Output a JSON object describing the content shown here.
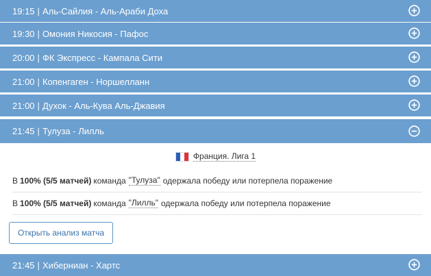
{
  "matches": [
    {
      "time": "19:15",
      "teams": "Аль-Сайлия - Аль-Араби Доха",
      "icon": "plus-circle-icon"
    },
    {
      "time": "19:30",
      "teams": "Омония Никосия - Пафос",
      "icon": "plus-circle-icon"
    },
    {
      "time": "20:00",
      "teams": "ФК Экспресс - Кампала Сити",
      "icon": "plus-circle-icon"
    },
    {
      "time": "21:00",
      "teams": "Копенгаген - Норшелланн",
      "icon": "plus-circle-icon"
    },
    {
      "time": "21:00",
      "teams": "Духок - Аль-Кува Аль-Джавия",
      "icon": "plus-circle-icon"
    },
    {
      "time": "21:45",
      "teams": "Тулуза - Лилль",
      "icon": "minus-circle-icon"
    },
    {
      "time": "21:45",
      "teams": "Хиберниан - Хартс",
      "icon": "plus-circle-icon"
    }
  ],
  "separator": "|",
  "expanded": {
    "league_name": "Франция. Лига 1",
    "flag_colors": [
      "#2c5eb5",
      "#ffffff",
      "#e0333a"
    ],
    "stats": [
      {
        "prefix": "В",
        "percent": "100% (5/5 матчей)",
        "mid": "команда",
        "team": "\"Тулуза\"",
        "suffix": "одержала победу или потерпела поражение"
      },
      {
        "prefix": "В",
        "percent": "100% (5/5 матчей)",
        "mid": "команда",
        "team": "\"Лилль\"",
        "suffix": "одержала победу или потерпела поражение"
      }
    ],
    "button_label": "Открыть анализ матча"
  },
  "colors": {
    "row_bg": "#6b9fcf",
    "accent": "#3a73ab"
  }
}
